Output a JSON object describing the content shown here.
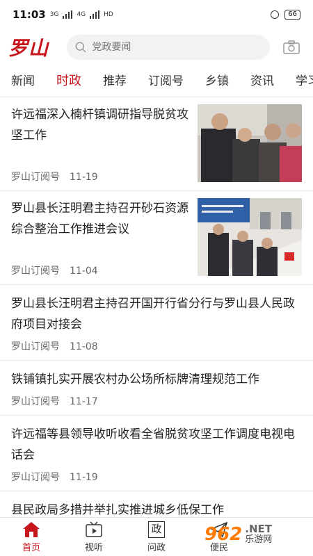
{
  "status_bar": {
    "time": "11:03",
    "signal_1": "3G",
    "signal_2": "4G",
    "hd": "HD",
    "battery": "66"
  },
  "header": {
    "logo": "罗山",
    "search_placeholder": "党政要闻"
  },
  "tabs": [
    {
      "label": "新闻",
      "active": false
    },
    {
      "label": "时政",
      "active": true
    },
    {
      "label": "推荐",
      "active": false
    },
    {
      "label": "订阅号",
      "active": false
    },
    {
      "label": "乡镇",
      "active": false
    },
    {
      "label": "资讯",
      "active": false
    },
    {
      "label": "学习",
      "active": false
    }
  ],
  "articles": [
    {
      "title": "许远福深入楠杆镇调研指导脱贫攻坚工作",
      "source": "罗山订阅号",
      "date": "11-19"
    },
    {
      "title": "罗山县长汪明君主持召开砂石资源综合整治工作推进会议",
      "source": "罗山订阅号",
      "date": "11-04"
    },
    {
      "title": "罗山县长汪明君主持召开国开行省分行与罗山县人民政府项目对接会",
      "source": "罗山订阅号",
      "date": "11-08"
    },
    {
      "title": "铁铺镇扎实开展农村办公场所标牌清理规范工作",
      "source": "罗山订阅号",
      "date": "11-17"
    },
    {
      "title": "许远福等县领导收听收看全省脱贫攻坚工作调度电视电话会",
      "source": "罗山订阅号",
      "date": "11-19"
    },
    {
      "title": "县民政局多措并举扎实推进城乡低保工作",
      "source": "",
      "date": ""
    }
  ],
  "bottom_nav": [
    {
      "label": "首页",
      "icon": "home-icon"
    },
    {
      "label": "视听",
      "icon": "tv-icon"
    },
    {
      "label": "问政",
      "icon": "zheng-icon",
      "glyph": "政"
    },
    {
      "label": "便民",
      "icon": "send-icon"
    }
  ],
  "watermark": {
    "logo": "962",
    "net": ".NET",
    "cn": "乐游网"
  },
  "colors": {
    "accent": "#c8161d",
    "watermark": "#ff7a00"
  }
}
